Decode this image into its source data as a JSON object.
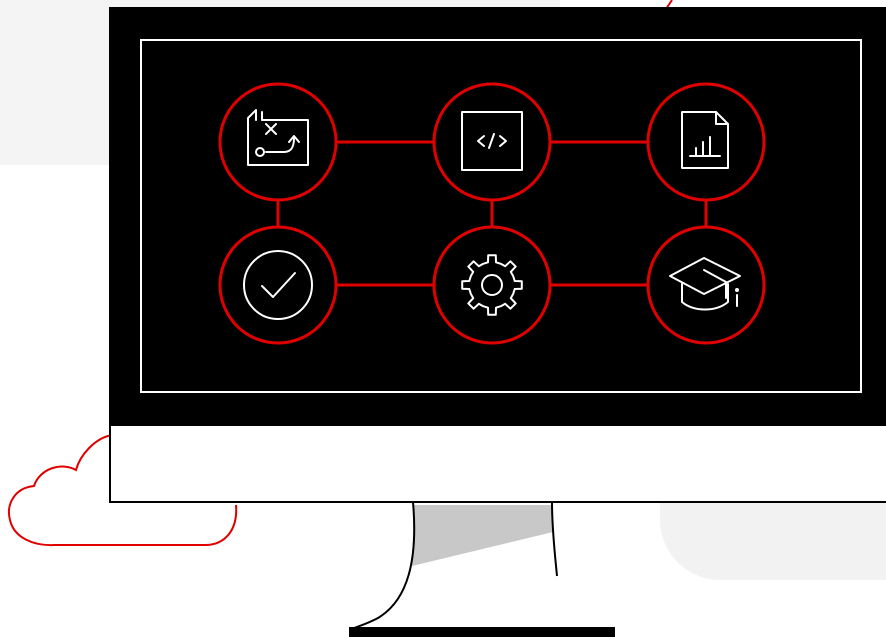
{
  "colors": {
    "accent": "#e00000",
    "screen": "#000000",
    "frame": "#ffffff",
    "outline": "#000000",
    "stand_shadow": "#c8c8c8",
    "bg_panel": "#f4f4f4"
  },
  "icons": [
    "roadmap-icon",
    "code-icon",
    "report-chart-icon",
    "checkmark-icon",
    "gear-icon",
    "graduation-cap-icon"
  ]
}
